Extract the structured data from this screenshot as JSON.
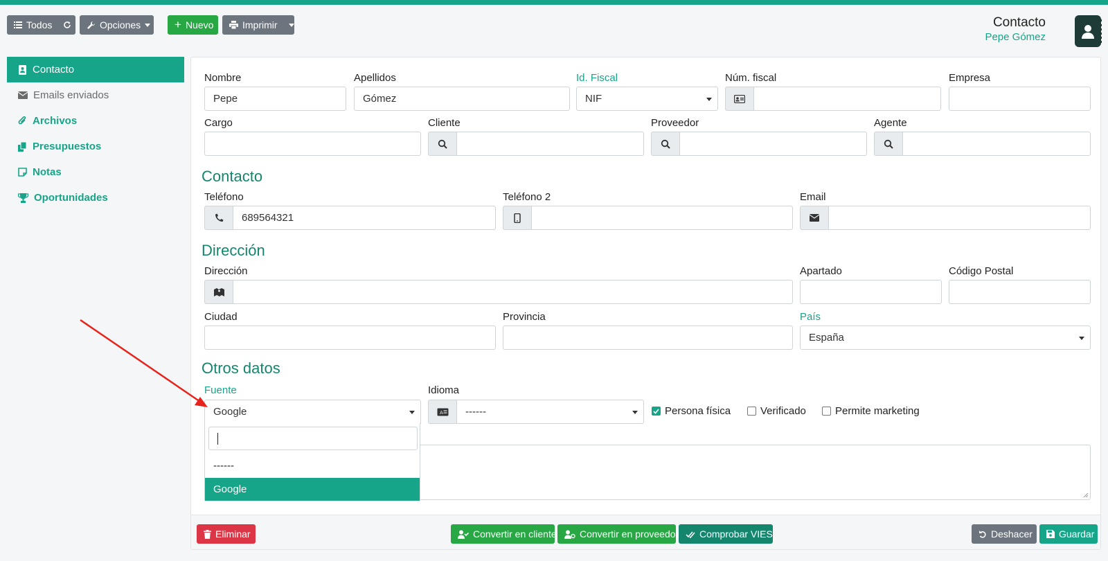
{
  "toolbar": {
    "all_label": "Todos",
    "options_label": "Opciones",
    "new_label": "Nuevo",
    "print_label": "Imprimir"
  },
  "header": {
    "title": "Contacto",
    "subtitle": "Pepe Gómez"
  },
  "sidebar": {
    "items": [
      {
        "label": "Contacto"
      },
      {
        "label": "Emails enviados"
      },
      {
        "label": "Archivos"
      },
      {
        "label": "Presupuestos"
      },
      {
        "label": "Notas"
      },
      {
        "label": "Oportunidades"
      }
    ]
  },
  "form": {
    "nombre": {
      "label": "Nombre",
      "value": "Pepe"
    },
    "apellidos": {
      "label": "Apellidos",
      "value": "Gómez"
    },
    "id_fiscal": {
      "label": "Id. Fiscal",
      "value": "NIF"
    },
    "num_fiscal": {
      "label": "Núm. fiscal",
      "value": ""
    },
    "empresa": {
      "label": "Empresa",
      "value": ""
    },
    "cargo": {
      "label": "Cargo",
      "value": ""
    },
    "cliente": {
      "label": "Cliente",
      "value": ""
    },
    "proveedor": {
      "label": "Proveedor",
      "value": ""
    },
    "agente": {
      "label": "Agente",
      "value": ""
    },
    "section_contacto": "Contacto",
    "telefono": {
      "label": "Teléfono",
      "value": "689564321"
    },
    "telefono2": {
      "label": "Teléfono 2",
      "value": ""
    },
    "email": {
      "label": "Email",
      "value": ""
    },
    "section_direccion": "Dirección",
    "direccion": {
      "label": "Dirección",
      "value": ""
    },
    "apartado": {
      "label": "Apartado",
      "value": ""
    },
    "codigo_postal": {
      "label": "Código Postal",
      "value": ""
    },
    "ciudad": {
      "label": "Ciudad",
      "value": ""
    },
    "provincia": {
      "label": "Provincia",
      "value": ""
    },
    "pais": {
      "label": "País",
      "value": "España"
    },
    "section_otros": "Otros datos",
    "fuente": {
      "label": "Fuente",
      "value": "Google"
    },
    "idioma": {
      "label": "Idioma",
      "value": "------"
    },
    "persona_fisica": "Persona física",
    "verificado": "Verificado",
    "permite_marketing": "Permite marketing"
  },
  "dropdown": {
    "options": [
      "------",
      "Google"
    ],
    "selected": "Google"
  },
  "footer": {
    "delete_label": "Eliminar",
    "convert_client_label": "Convertir en cliente",
    "convert_supplier_label": "Convertir en proveedor",
    "vies_label": "Comprobar VIES",
    "undo_label": "Deshacer",
    "save_label": "Guardar"
  },
  "colors": {
    "accent": "#17a589",
    "danger": "#dc3545",
    "success": "#28a745",
    "secondary": "#6c757d",
    "annotation": "#e8231b"
  }
}
